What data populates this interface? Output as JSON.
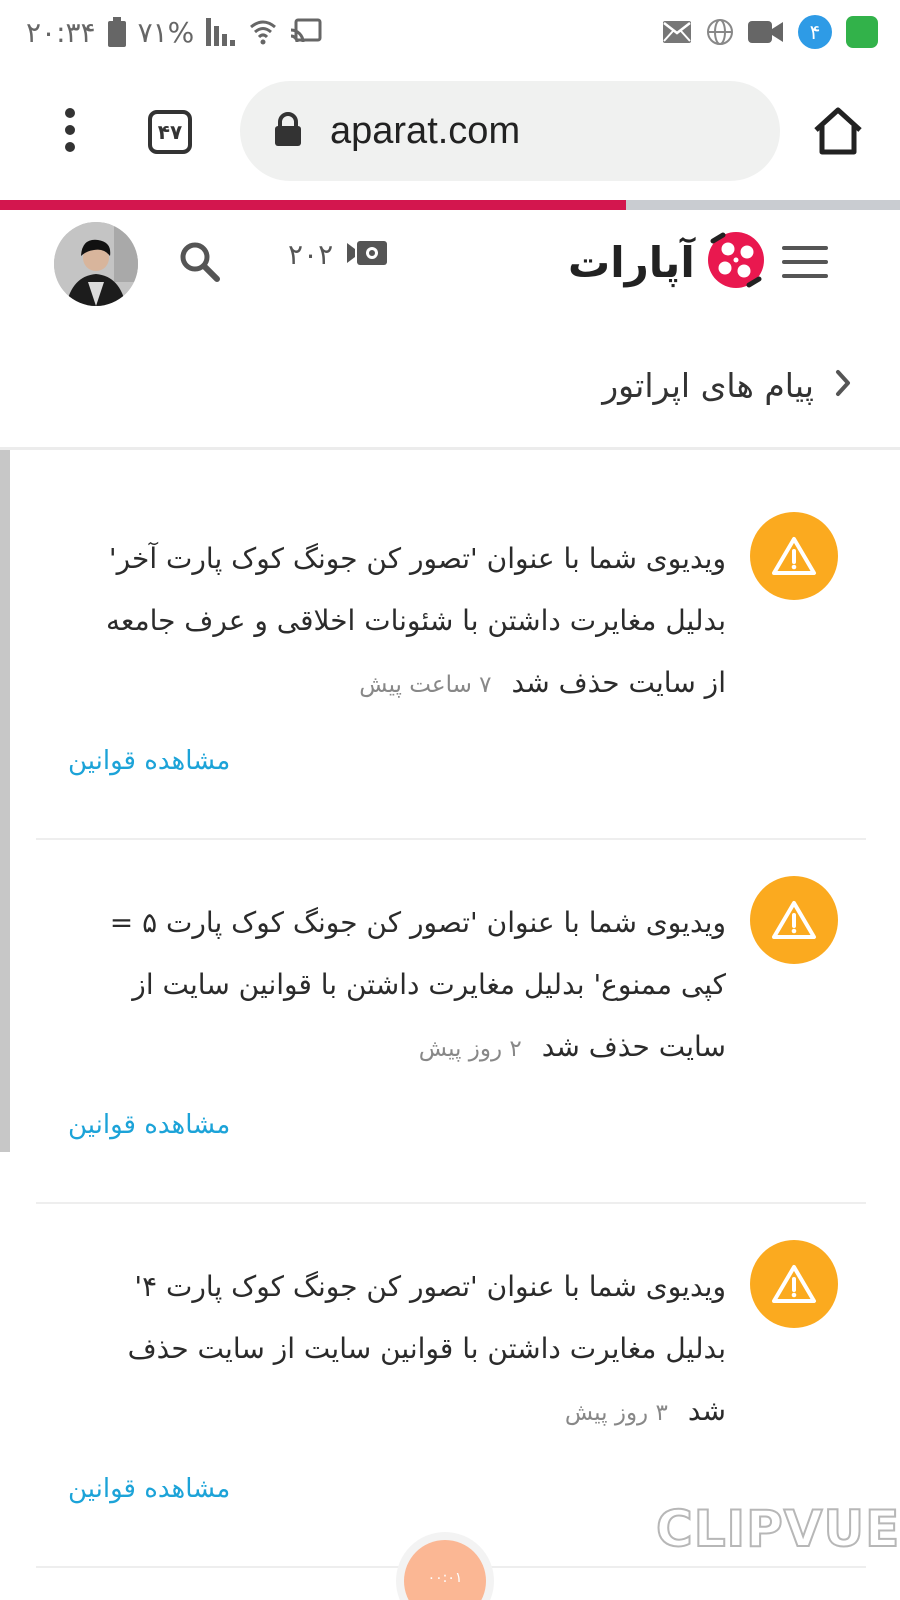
{
  "status_bar": {
    "time": "۲۰:۳۴",
    "battery": "۷۱%",
    "notification_count": "۴"
  },
  "browser": {
    "url": "aparat.com",
    "tab_count": "۴۷"
  },
  "page_progress": 0.695,
  "header": {
    "upload_count": "۲۰۲",
    "logo_text": "آپارات"
  },
  "page": {
    "title": "پیام های اپراتور"
  },
  "messages": [
    {
      "text": "ویدیوی شما با عنوان 'تصور کن جونگ کوک پارت آخر' بدلیل مغایرت داشتن با شئونات اخلاقی و عرف جامعه از سایت حذف شد",
      "time": "۷ ساعت پیش",
      "link": "مشاهده قوانین"
    },
    {
      "text": "ویدیوی شما با عنوان 'تصور کن جونگ کوک پارت ۵ = کپی ممنوع' بدلیل مغایرت داشتن با قوانین سایت از سایت حذف شد",
      "time": "۲ روز پیش",
      "link": "مشاهده قوانین"
    },
    {
      "text": "ویدیوی شما با عنوان 'تصور کن جونگ کوک پارت ۴' بدلیل مغایرت داشتن با قوانین سایت از سایت حذف شد",
      "time": "۳ روز پیش",
      "link": "مشاهده قوانین"
    }
  ],
  "fab_label": "۰۰:۰۱",
  "watermark": "CLIPVUE",
  "colors": {
    "accent_red": "#d3164e",
    "warning": "#fbaa1f",
    "link": "#1ca3d8"
  }
}
